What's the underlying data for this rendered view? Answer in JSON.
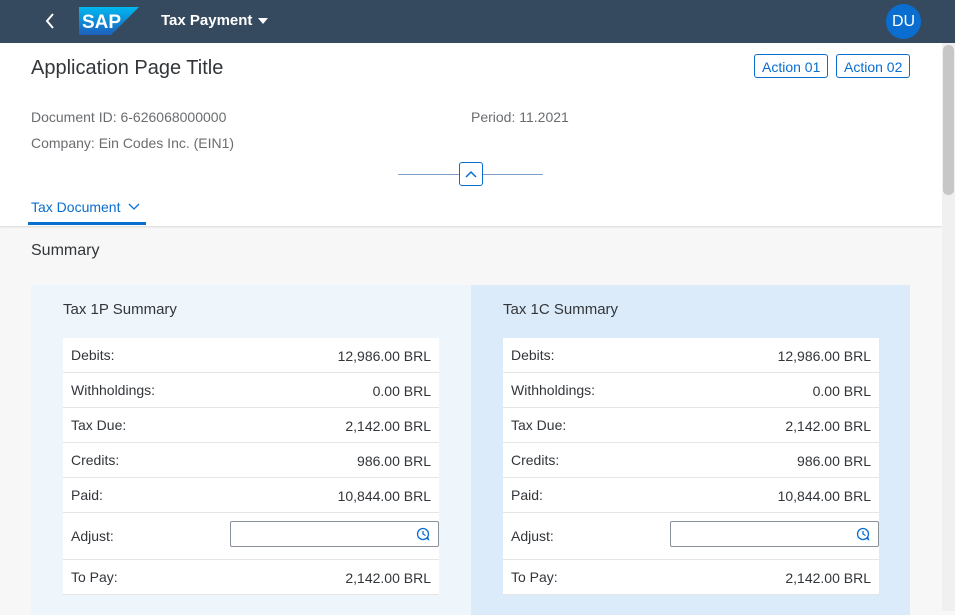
{
  "shell": {
    "app_title": "Tax Payment",
    "avatar_initials": "DU",
    "logo_text": "SAP"
  },
  "header": {
    "page_title": "Application Page Title",
    "actions": [
      "Action 01",
      "Action 02"
    ],
    "document_id": "Document ID: 6-626068000000",
    "period": "Period: 11.2021",
    "company": "Company: Ein Codes Inc. (EIN1)"
  },
  "tabs": [
    {
      "label": "Tax Document",
      "selected": true
    }
  ],
  "summary": {
    "title": "Summary",
    "panels": [
      {
        "title": "Tax 1P Summary",
        "rows": [
          {
            "label": "Debits:",
            "value": "12,986.00 BRL"
          },
          {
            "label": "Withholdings:",
            "value": "0.00 BRL"
          },
          {
            "label": "Tax Due:",
            "value": "2,142.00 BRL"
          },
          {
            "label": "Credits:",
            "value": "986.00 BRL"
          },
          {
            "label": "Paid:",
            "value": "10,844.00 BRL"
          },
          {
            "label": "Adjust:",
            "value": ""
          },
          {
            "label": "To Pay:",
            "value": "2,142.00 BRL"
          }
        ]
      },
      {
        "title": "Tax 1C Summary",
        "rows": [
          {
            "label": "Debits:",
            "value": "12,986.00 BRL"
          },
          {
            "label": "Withholdings:",
            "value": "0.00 BRL"
          },
          {
            "label": "Tax Due:",
            "value": "2,142.00 BRL"
          },
          {
            "label": "Credits:",
            "value": "986.00 BRL"
          },
          {
            "label": "Paid:",
            "value": "10,844.00 BRL"
          },
          {
            "label": "Adjust:",
            "value": ""
          },
          {
            "label": "To Pay:",
            "value": "2,142.00 BRL"
          }
        ]
      }
    ]
  },
  "colors": {
    "shell_bg": "#354a5f",
    "accent": "#0a6ed1",
    "panel1_bg": "#eef5fb",
    "panel2_bg": "#dcebfa"
  }
}
